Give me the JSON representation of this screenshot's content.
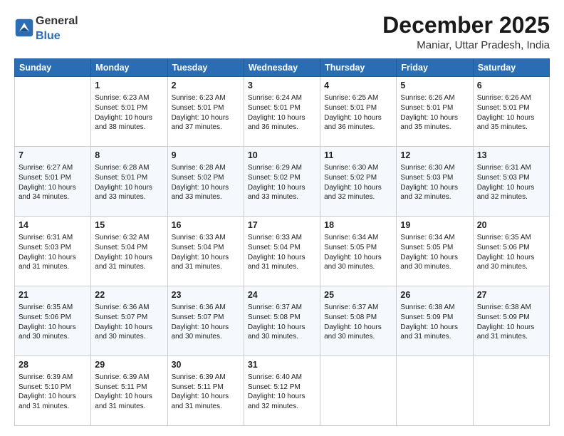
{
  "header": {
    "logo_general": "General",
    "logo_blue": "Blue",
    "month_title": "December 2025",
    "subtitle": "Maniar, Uttar Pradesh, India"
  },
  "columns": [
    "Sunday",
    "Monday",
    "Tuesday",
    "Wednesday",
    "Thursday",
    "Friday",
    "Saturday"
  ],
  "weeks": [
    {
      "days": [
        {
          "num": "",
          "text": ""
        },
        {
          "num": "1",
          "text": "Sunrise: 6:23 AM\nSunset: 5:01 PM\nDaylight: 10 hours\nand 38 minutes."
        },
        {
          "num": "2",
          "text": "Sunrise: 6:23 AM\nSunset: 5:01 PM\nDaylight: 10 hours\nand 37 minutes."
        },
        {
          "num": "3",
          "text": "Sunrise: 6:24 AM\nSunset: 5:01 PM\nDaylight: 10 hours\nand 36 minutes."
        },
        {
          "num": "4",
          "text": "Sunrise: 6:25 AM\nSunset: 5:01 PM\nDaylight: 10 hours\nand 36 minutes."
        },
        {
          "num": "5",
          "text": "Sunrise: 6:26 AM\nSunset: 5:01 PM\nDaylight: 10 hours\nand 35 minutes."
        },
        {
          "num": "6",
          "text": "Sunrise: 6:26 AM\nSunset: 5:01 PM\nDaylight: 10 hours\nand 35 minutes."
        }
      ]
    },
    {
      "days": [
        {
          "num": "7",
          "text": "Sunrise: 6:27 AM\nSunset: 5:01 PM\nDaylight: 10 hours\nand 34 minutes."
        },
        {
          "num": "8",
          "text": "Sunrise: 6:28 AM\nSunset: 5:01 PM\nDaylight: 10 hours\nand 33 minutes."
        },
        {
          "num": "9",
          "text": "Sunrise: 6:28 AM\nSunset: 5:02 PM\nDaylight: 10 hours\nand 33 minutes."
        },
        {
          "num": "10",
          "text": "Sunrise: 6:29 AM\nSunset: 5:02 PM\nDaylight: 10 hours\nand 33 minutes."
        },
        {
          "num": "11",
          "text": "Sunrise: 6:30 AM\nSunset: 5:02 PM\nDaylight: 10 hours\nand 32 minutes."
        },
        {
          "num": "12",
          "text": "Sunrise: 6:30 AM\nSunset: 5:03 PM\nDaylight: 10 hours\nand 32 minutes."
        },
        {
          "num": "13",
          "text": "Sunrise: 6:31 AM\nSunset: 5:03 PM\nDaylight: 10 hours\nand 32 minutes."
        }
      ]
    },
    {
      "days": [
        {
          "num": "14",
          "text": "Sunrise: 6:31 AM\nSunset: 5:03 PM\nDaylight: 10 hours\nand 31 minutes."
        },
        {
          "num": "15",
          "text": "Sunrise: 6:32 AM\nSunset: 5:04 PM\nDaylight: 10 hours\nand 31 minutes."
        },
        {
          "num": "16",
          "text": "Sunrise: 6:33 AM\nSunset: 5:04 PM\nDaylight: 10 hours\nand 31 minutes."
        },
        {
          "num": "17",
          "text": "Sunrise: 6:33 AM\nSunset: 5:04 PM\nDaylight: 10 hours\nand 31 minutes."
        },
        {
          "num": "18",
          "text": "Sunrise: 6:34 AM\nSunset: 5:05 PM\nDaylight: 10 hours\nand 30 minutes."
        },
        {
          "num": "19",
          "text": "Sunrise: 6:34 AM\nSunset: 5:05 PM\nDaylight: 10 hours\nand 30 minutes."
        },
        {
          "num": "20",
          "text": "Sunrise: 6:35 AM\nSunset: 5:06 PM\nDaylight: 10 hours\nand 30 minutes."
        }
      ]
    },
    {
      "days": [
        {
          "num": "21",
          "text": "Sunrise: 6:35 AM\nSunset: 5:06 PM\nDaylight: 10 hours\nand 30 minutes."
        },
        {
          "num": "22",
          "text": "Sunrise: 6:36 AM\nSunset: 5:07 PM\nDaylight: 10 hours\nand 30 minutes."
        },
        {
          "num": "23",
          "text": "Sunrise: 6:36 AM\nSunset: 5:07 PM\nDaylight: 10 hours\nand 30 minutes."
        },
        {
          "num": "24",
          "text": "Sunrise: 6:37 AM\nSunset: 5:08 PM\nDaylight: 10 hours\nand 30 minutes."
        },
        {
          "num": "25",
          "text": "Sunrise: 6:37 AM\nSunset: 5:08 PM\nDaylight: 10 hours\nand 30 minutes."
        },
        {
          "num": "26",
          "text": "Sunrise: 6:38 AM\nSunset: 5:09 PM\nDaylight: 10 hours\nand 31 minutes."
        },
        {
          "num": "27",
          "text": "Sunrise: 6:38 AM\nSunset: 5:09 PM\nDaylight: 10 hours\nand 31 minutes."
        }
      ]
    },
    {
      "days": [
        {
          "num": "28",
          "text": "Sunrise: 6:39 AM\nSunset: 5:10 PM\nDaylight: 10 hours\nand 31 minutes."
        },
        {
          "num": "29",
          "text": "Sunrise: 6:39 AM\nSunset: 5:11 PM\nDaylight: 10 hours\nand 31 minutes."
        },
        {
          "num": "30",
          "text": "Sunrise: 6:39 AM\nSunset: 5:11 PM\nDaylight: 10 hours\nand 31 minutes."
        },
        {
          "num": "31",
          "text": "Sunrise: 6:40 AM\nSunset: 5:12 PM\nDaylight: 10 hours\nand 32 minutes."
        },
        {
          "num": "",
          "text": ""
        },
        {
          "num": "",
          "text": ""
        },
        {
          "num": "",
          "text": ""
        }
      ]
    }
  ]
}
